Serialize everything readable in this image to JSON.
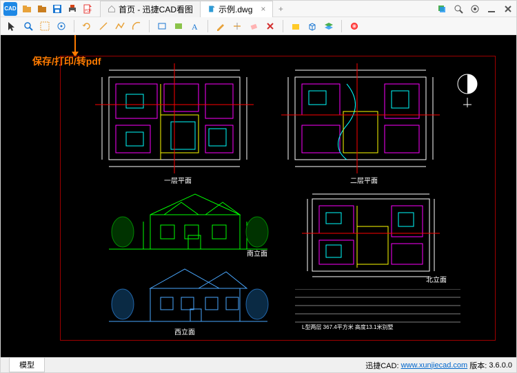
{
  "app": {
    "logo_text": "CAD",
    "annotation_label": "保存/打印/转pdf"
  },
  "top_icons": [
    {
      "name": "open-icon",
      "color": "#e8a23a"
    },
    {
      "name": "open-folder-icon",
      "color": "#c97d1f"
    },
    {
      "name": "save-icon",
      "color": "#1976d2"
    },
    {
      "name": "print-icon",
      "color": "#d84315"
    },
    {
      "name": "export-pdf-icon",
      "color": "#e53935"
    }
  ],
  "tabs": [
    {
      "label": "首页 - 迅捷CAD看图",
      "icon": "home-icon",
      "active": false
    },
    {
      "label": "示例.dwg",
      "icon": "dwg-icon",
      "active": true
    }
  ],
  "win_controls": [
    {
      "name": "layers-icon"
    },
    {
      "name": "zoom-icon"
    },
    {
      "name": "settings-icon"
    },
    {
      "name": "minimize-icon"
    },
    {
      "name": "close-icon"
    }
  ],
  "toolbar_row2": [
    {
      "name": "cursor-icon"
    },
    {
      "name": "zoom-extents-icon"
    },
    {
      "name": "select-window-icon"
    },
    {
      "name": "pan-icon"
    },
    {
      "type": "sep"
    },
    {
      "name": "rotate-icon"
    },
    {
      "name": "line-icon"
    },
    {
      "name": "polyline-icon"
    },
    {
      "name": "arc-icon"
    },
    {
      "type": "sep"
    },
    {
      "name": "rectangle-icon"
    },
    {
      "name": "fill-icon"
    },
    {
      "name": "text-icon"
    },
    {
      "type": "sep"
    },
    {
      "name": "edit-icon"
    },
    {
      "name": "trim-icon"
    },
    {
      "name": "erase-icon"
    },
    {
      "name": "delete-icon"
    },
    {
      "type": "sep"
    },
    {
      "name": "block-icon"
    },
    {
      "name": "3d-box-icon"
    },
    {
      "name": "layers-palette-icon"
    },
    {
      "type": "sep"
    },
    {
      "name": "color-wheel-icon"
    }
  ],
  "bottom_tabs": [
    "模型"
  ],
  "status": {
    "brand": "迅捷CAD:",
    "url_text": "www.xunjiecad.com",
    "url_href": "http://www.xunjiecad.com",
    "version_label": "版本:",
    "version_value": "3.6.0.0"
  },
  "drawing": {
    "plan_labels": [
      "一层平面",
      "二层平面"
    ],
    "elev_labels": [
      "南立面",
      "西立面",
      "北立面"
    ]
  }
}
